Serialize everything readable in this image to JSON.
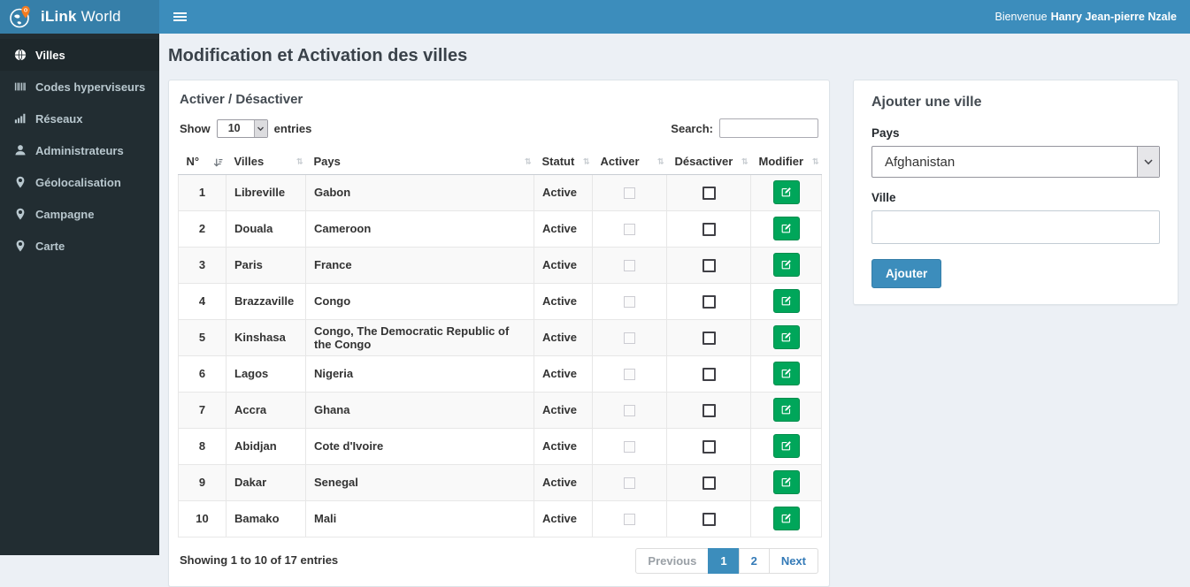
{
  "navbar": {
    "brand_bold": "iLink",
    "brand_rest": "World",
    "welcome_prefix": "Bienvenue",
    "user_name": "Hanry Jean-pierre Nzale"
  },
  "sidebar": {
    "items": [
      {
        "id": "villes",
        "label": "Villes",
        "icon": "globe-icon",
        "active": true
      },
      {
        "id": "codes-hyperviseurs",
        "label": "Codes hyperviseurs",
        "icon": "barcode-icon",
        "active": false
      },
      {
        "id": "reseaux",
        "label": "Réseaux",
        "icon": "signal-icon",
        "active": false
      },
      {
        "id": "administrateurs",
        "label": "Administrateurs",
        "icon": "user-icon",
        "active": false
      },
      {
        "id": "geolocalisation",
        "label": "Géolocalisation",
        "icon": "map-marker-icon",
        "active": false
      },
      {
        "id": "campagne",
        "label": "Campagne",
        "icon": "map-marker-icon",
        "active": false
      },
      {
        "id": "carte",
        "label": "Carte",
        "icon": "map-marker-icon",
        "active": false
      }
    ]
  },
  "page": {
    "title": "Modification et Activation des villes"
  },
  "table_panel": {
    "title": "Activer / Désactiver",
    "show_label": "Show",
    "page_size": "10",
    "entries_label": "entries",
    "search_label": "Search:",
    "search_value": "",
    "headers": [
      "N°",
      "Villes",
      "Pays",
      "Statut",
      "Activer",
      "Désactiver",
      "Modifier"
    ],
    "rows": [
      {
        "no": "1",
        "ville": "Libreville",
        "pays": "Gabon",
        "statut": "Active",
        "activer_checked": false,
        "desactiver_checked": false
      },
      {
        "no": "2",
        "ville": "Douala",
        "pays": "Cameroon",
        "statut": "Active",
        "activer_checked": false,
        "desactiver_checked": false
      },
      {
        "no": "3",
        "ville": "Paris",
        "pays": "France",
        "statut": "Active",
        "activer_checked": false,
        "desactiver_checked": false
      },
      {
        "no": "4",
        "ville": "Brazzaville",
        "pays": "Congo",
        "statut": "Active",
        "activer_checked": false,
        "desactiver_checked": false
      },
      {
        "no": "5",
        "ville": "Kinshasa",
        "pays": "Congo, The Democratic Republic of the Congo",
        "statut": "Active",
        "activer_checked": false,
        "desactiver_checked": false
      },
      {
        "no": "6",
        "ville": "Lagos",
        "pays": "Nigeria",
        "statut": "Active",
        "activer_checked": false,
        "desactiver_checked": false
      },
      {
        "no": "7",
        "ville": "Accra",
        "pays": "Ghana",
        "statut": "Active",
        "activer_checked": false,
        "desactiver_checked": false
      },
      {
        "no": "8",
        "ville": "Abidjan",
        "pays": "Cote d'Ivoire",
        "statut": "Active",
        "activer_checked": false,
        "desactiver_checked": false
      },
      {
        "no": "9",
        "ville": "Dakar",
        "pays": "Senegal",
        "statut": "Active",
        "activer_checked": false,
        "desactiver_checked": false
      },
      {
        "no": "10",
        "ville": "Bamako",
        "pays": "Mali",
        "statut": "Active",
        "activer_checked": false,
        "desactiver_checked": false
      }
    ],
    "footer_summary": "Showing 1 to 10 of 17 entries",
    "pagination": {
      "previous": "Previous",
      "pages": [
        "1",
        "2"
      ],
      "active_page": "1",
      "next": "Next"
    }
  },
  "add_panel": {
    "title": "Ajouter une ville",
    "pays_label": "Pays",
    "selected_country": "Afghanistan",
    "ville_label": "Ville",
    "ville_value": "",
    "submit_label": "Ajouter"
  },
  "colors": {
    "navbar": "#3c8dbc",
    "logo_bg": "#367fa9",
    "sidebar_bg": "#222d32",
    "sidebar_active_bg": "#1e282c",
    "content_bg": "#ecf0f5",
    "success_button": "#00a65a",
    "accent": "#3c8dbc",
    "pin_orange": "#f47b20"
  }
}
